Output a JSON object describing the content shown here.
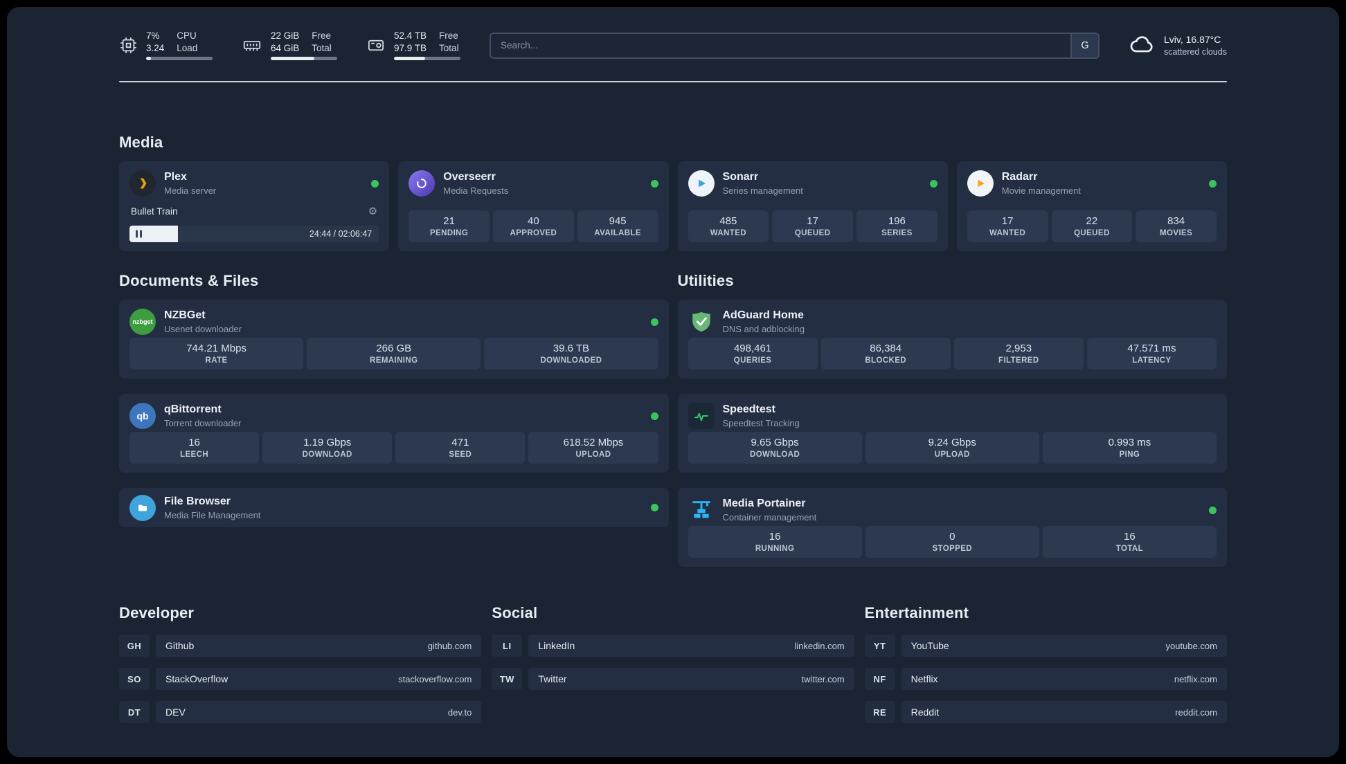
{
  "topbar": {
    "cpu": {
      "value_top": "7%",
      "value_bottom": "3.24",
      "label_top": "CPU",
      "label_bottom": "Load",
      "bar_percent": 7
    },
    "ram": {
      "value_top": "22 GiB",
      "value_bottom": "64 GiB",
      "label_top": "Free",
      "label_bottom": "Total",
      "bar_percent": 66
    },
    "disk": {
      "value_top": "52.4 TB",
      "value_bottom": "97.9 TB",
      "label_top": "Free",
      "label_bottom": "Total",
      "bar_percent": 47
    },
    "search": {
      "placeholder": "Search...",
      "engine_button": "G"
    },
    "weather": {
      "location": "Lviv, 16.87°C",
      "condition": "scattered clouds"
    }
  },
  "icons": {
    "gear": "⚙",
    "plex_chevron": "plex-arrow",
    "status": "green-dot"
  },
  "sections": {
    "media": {
      "title": "Media"
    },
    "documents": {
      "title": "Documents & Files"
    },
    "utilities": {
      "title": "Utilities"
    },
    "developer": {
      "title": "Developer"
    },
    "social": {
      "title": "Social"
    },
    "entertainment": {
      "title": "Entertainment"
    }
  },
  "apps": {
    "plex": {
      "name": "Plex",
      "subtitle": "Media server",
      "now_playing": "Bullet Train",
      "progress_percent": 19.5,
      "time": "24:44 / 02:06:47"
    },
    "overseerr": {
      "name": "Overseerr",
      "subtitle": "Media Requests",
      "stats": [
        {
          "value": "21",
          "label": "PENDING"
        },
        {
          "value": "40",
          "label": "APPROVED"
        },
        {
          "value": "945",
          "label": "AVAILABLE"
        }
      ]
    },
    "sonarr": {
      "name": "Sonarr",
      "subtitle": "Series management",
      "stats": [
        {
          "value": "485",
          "label": "WANTED"
        },
        {
          "value": "17",
          "label": "QUEUED"
        },
        {
          "value": "196",
          "label": "SERIES"
        }
      ]
    },
    "radarr": {
      "name": "Radarr",
      "subtitle": "Movie management",
      "stats": [
        {
          "value": "17",
          "label": "WANTED"
        },
        {
          "value": "22",
          "label": "QUEUED"
        },
        {
          "value": "834",
          "label": "MOVIES"
        }
      ]
    },
    "nzbget": {
      "name": "NZBGet",
      "subtitle": "Usenet downloader",
      "icon_text": "nzbget",
      "stats": [
        {
          "value": "744.21 Mbps",
          "label": "RATE"
        },
        {
          "value": "266 GB",
          "label": "REMAINING"
        },
        {
          "value": "39.6 TB",
          "label": "DOWNLOADED"
        }
      ]
    },
    "qbittorrent": {
      "name": "qBittorrent",
      "subtitle": "Torrent downloader",
      "icon_text": "qb",
      "stats": [
        {
          "value": "16",
          "label": "LEECH"
        },
        {
          "value": "1.19 Gbps",
          "label": "DOWNLOAD"
        },
        {
          "value": "471",
          "label": "SEED"
        },
        {
          "value": "618.52 Mbps",
          "label": "UPLOAD"
        }
      ]
    },
    "filebrowser": {
      "name": "File Browser",
      "subtitle": "Media File Management"
    },
    "adguard": {
      "name": "AdGuard Home",
      "subtitle": "DNS and adblocking",
      "stats": [
        {
          "value": "498,461",
          "label": "QUERIES"
        },
        {
          "value": "86,384",
          "label": "BLOCKED"
        },
        {
          "value": "2,953",
          "label": "FILTERED"
        },
        {
          "value": "47.571 ms",
          "label": "LATENCY"
        }
      ]
    },
    "speedtest": {
      "name": "Speedtest",
      "subtitle": "Speedtest Tracking",
      "stats": [
        {
          "value": "9.65 Gbps",
          "label": "DOWNLOAD"
        },
        {
          "value": "9.24 Gbps",
          "label": "UPLOAD"
        },
        {
          "value": "0.993 ms",
          "label": "PING"
        }
      ]
    },
    "portainer": {
      "name": "Media Portainer",
      "subtitle": "Container management",
      "stats": [
        {
          "value": "16",
          "label": "RUNNING"
        },
        {
          "value": "0",
          "label": "STOPPED"
        },
        {
          "value": "16",
          "label": "TOTAL"
        }
      ]
    }
  },
  "bookmarks": {
    "developer": [
      {
        "abbr": "GH",
        "name": "Github",
        "domain": "github.com"
      },
      {
        "abbr": "SO",
        "name": "StackOverflow",
        "domain": "stackoverflow.com"
      },
      {
        "abbr": "DT",
        "name": "DEV",
        "domain": "dev.to"
      }
    ],
    "social": [
      {
        "abbr": "LI",
        "name": "LinkedIn",
        "domain": "linkedin.com"
      },
      {
        "abbr": "TW",
        "name": "Twitter",
        "domain": "twitter.com"
      }
    ],
    "entertainment": [
      {
        "abbr": "YT",
        "name": "YouTube",
        "domain": "youtube.com"
      },
      {
        "abbr": "NF",
        "name": "Netflix",
        "domain": "netflix.com"
      },
      {
        "abbr": "RE",
        "name": "Reddit",
        "domain": "reddit.com"
      }
    ]
  },
  "colors": {
    "background": "#1b2433",
    "card": "#232e42",
    "tile": "#2c3950",
    "status_online": "#3cc45c",
    "plex_gold": "#e5a00d",
    "divider": "#d7dce3"
  }
}
